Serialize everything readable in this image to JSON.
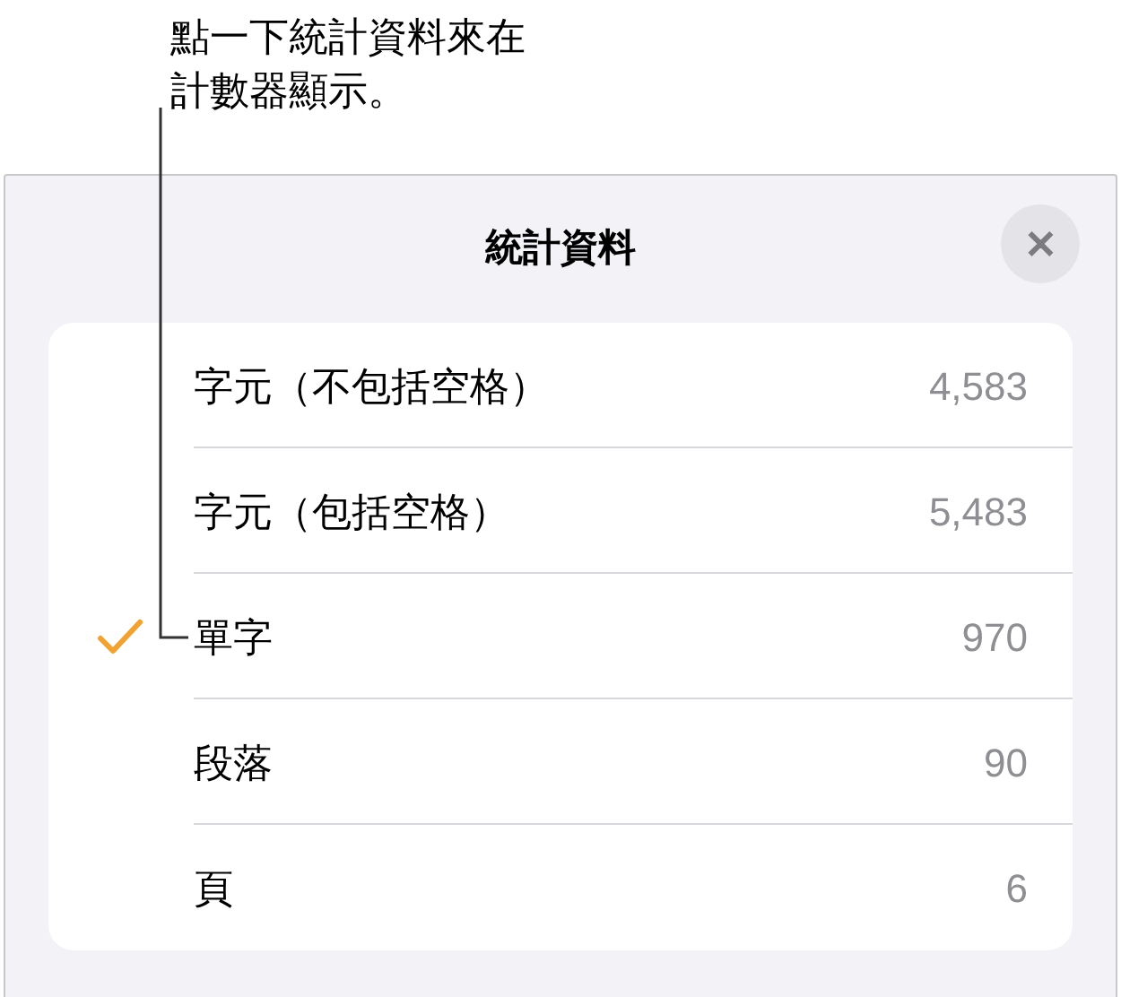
{
  "callout": {
    "lines": [
      "點一下統計資料來在",
      "計數器顯示。"
    ]
  },
  "panel": {
    "title": "統計資料",
    "close": "✕"
  },
  "rows": [
    {
      "label": "字元（不包括空格）",
      "value": "4,583",
      "selected": false
    },
    {
      "label": "字元（包括空格）",
      "value": "5,483",
      "selected": false
    },
    {
      "label": "單字",
      "value": "970",
      "selected": true
    },
    {
      "label": "段落",
      "value": "90",
      "selected": false
    },
    {
      "label": "頁",
      "value": "6",
      "selected": false
    }
  ]
}
